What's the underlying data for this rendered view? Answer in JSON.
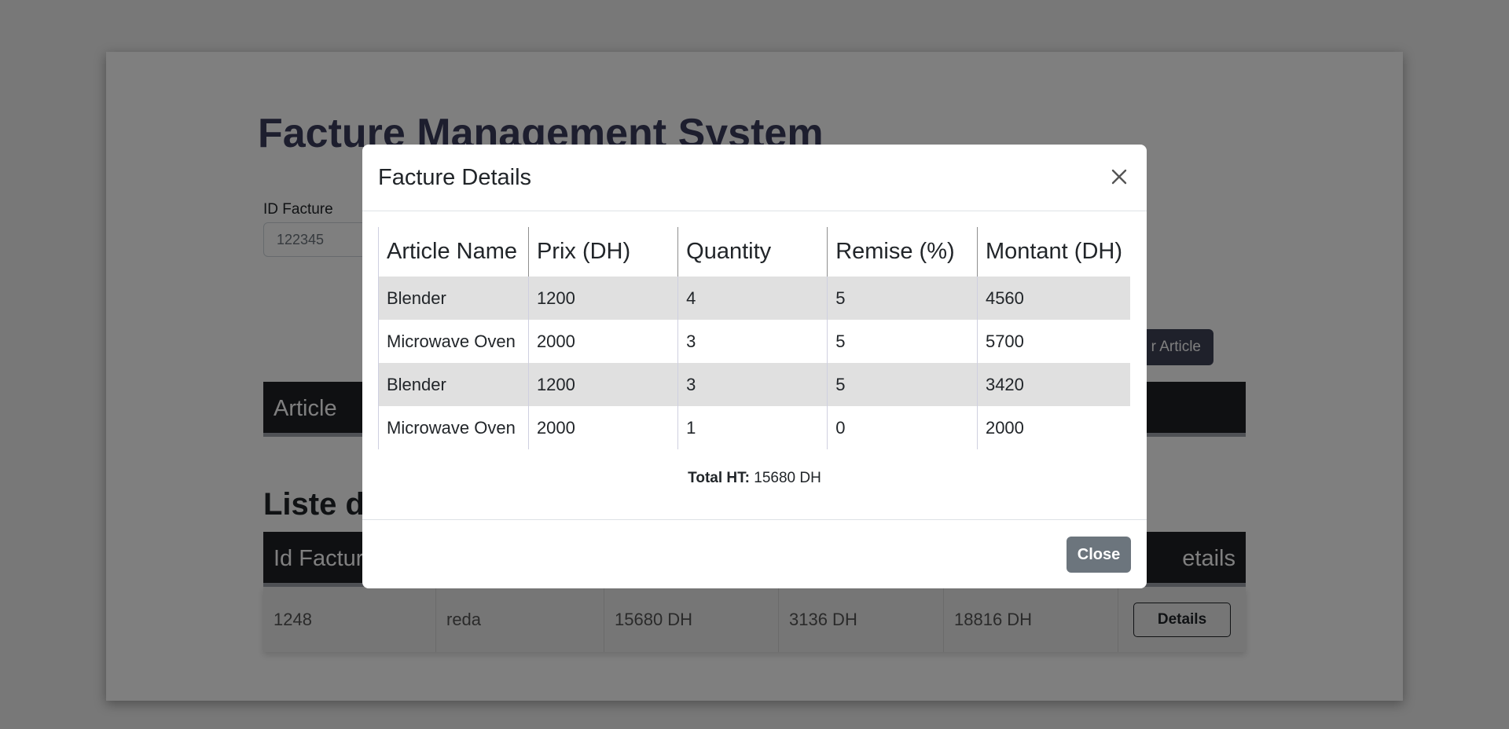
{
  "app": {
    "title": "Facture Management System",
    "id_label": "ID Facture",
    "id_value": "122345",
    "add_article_label": "r Article",
    "article_header": "Article",
    "list_title": "Liste de"
  },
  "invoices": {
    "headers": [
      "Id Facture",
      "",
      "",
      "",
      "",
      "etails"
    ],
    "rows": [
      {
        "id": "1248",
        "client": "reda",
        "ht": "15680 DH",
        "tva": "3136 DH",
        "ttc": "18816 DH",
        "action": "Details"
      }
    ]
  },
  "modal": {
    "title": "Facture Details",
    "columns": [
      "Article Name",
      "Prix (DH)",
      "Quantity",
      "Remise (%)",
      "Montant (DH)"
    ],
    "rows": [
      [
        "Blender",
        "1200",
        "4",
        "5",
        "4560"
      ],
      [
        "Microwave Oven",
        "2000",
        "3",
        "5",
        "5700"
      ],
      [
        "Blender",
        "1200",
        "3",
        "5",
        "3420"
      ],
      [
        "Microwave Oven",
        "2000",
        "1",
        "0",
        "2000"
      ]
    ],
    "total_label": "Total HT:",
    "total_value": "15680 DH",
    "close_label": "Close",
    "close_icon": "close-icon"
  },
  "colors": {
    "title": "#3a3d5c",
    "dark_header": "#1e2025",
    "close_button": "#6c757d",
    "stripe": "#e0e0e0"
  }
}
